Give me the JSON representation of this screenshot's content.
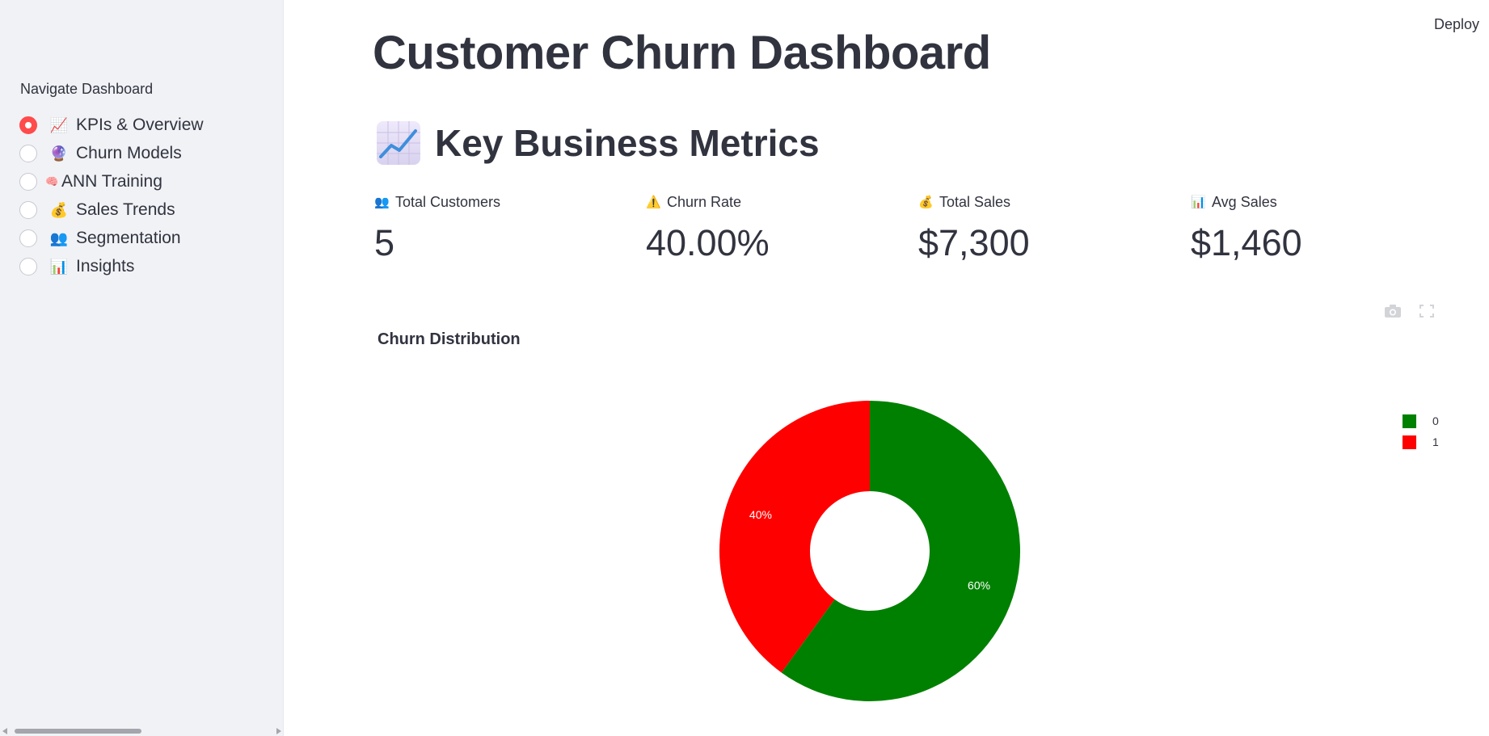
{
  "sidebar": {
    "label": "Navigate Dashboard",
    "items": [
      {
        "emoji": "📈",
        "icon": "chart-increasing-icon",
        "label": "KPIs & Overview",
        "selected": true
      },
      {
        "emoji": "🔮",
        "icon": "crystal-ball-icon",
        "label": "Churn Models",
        "selected": false
      },
      {
        "emoji": "🧠",
        "icon": "brain-icon",
        "label": "ANN Training",
        "selected": false
      },
      {
        "emoji": "💰",
        "icon": "money-bag-icon",
        "label": "Sales Trends",
        "selected": false
      },
      {
        "emoji": "👥",
        "icon": "people-icon",
        "label": "Segmentation",
        "selected": false
      },
      {
        "emoji": "📊",
        "icon": "bar-chart-icon",
        "label": "Insights",
        "selected": false
      }
    ]
  },
  "header": {
    "deploy_label": "Deploy"
  },
  "main": {
    "title": "Customer Churn Dashboard",
    "section_title": "Key Business Metrics",
    "metrics": [
      {
        "emoji": "👥",
        "label": "Total Customers",
        "value": "5"
      },
      {
        "emoji": "⚠️",
        "label": "Churn Rate",
        "value": "40.00%"
      },
      {
        "emoji": "💰",
        "label": "Total Sales",
        "value": "$7,300"
      },
      {
        "emoji": "📊",
        "label": "Avg Sales",
        "value": "$1,460"
      }
    ]
  },
  "colors": {
    "accent": "#ff4b4b",
    "series_0": "#008000",
    "series_1": "#ff0000"
  },
  "chart_data": {
    "type": "pie",
    "title": "Churn Distribution",
    "hole": true,
    "legend_position": "top-right",
    "slices": [
      {
        "label": "0",
        "value": 60,
        "text": "60%",
        "color": "#008000"
      },
      {
        "label": "1",
        "value": 40,
        "text": "40%",
        "color": "#ff0000"
      }
    ]
  }
}
